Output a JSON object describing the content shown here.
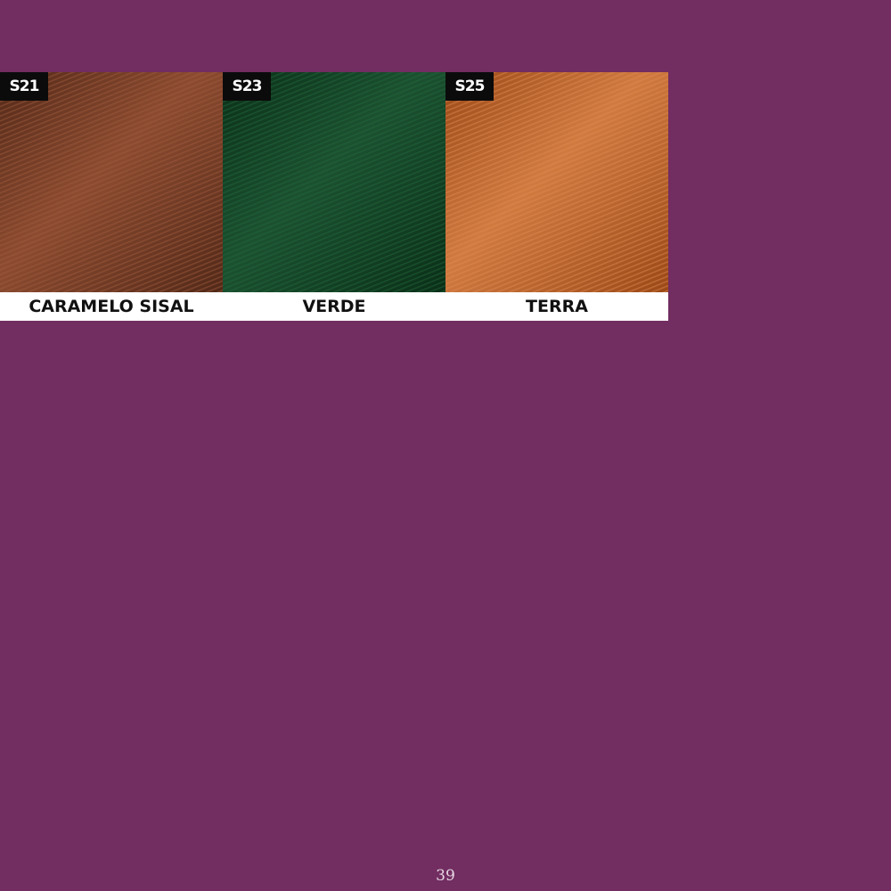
{
  "swatches": [
    {
      "code": "S21",
      "name": "CARAMELO SISAL",
      "color_light": "#8c4b30",
      "color_dark": "#512818",
      "weave": "#a35d3f"
    },
    {
      "code": "S23",
      "name": "VERDE",
      "color_light": "#1b5130",
      "color_dark": "#0a2f18",
      "weave": "#236a3c"
    },
    {
      "code": "S25",
      "name": "TERRA",
      "color_light": "#d07a40",
      "color_dark": "#9a4817",
      "weave": "#e18d52"
    }
  ],
  "page_number": "39",
  "background_color": "#722d61"
}
